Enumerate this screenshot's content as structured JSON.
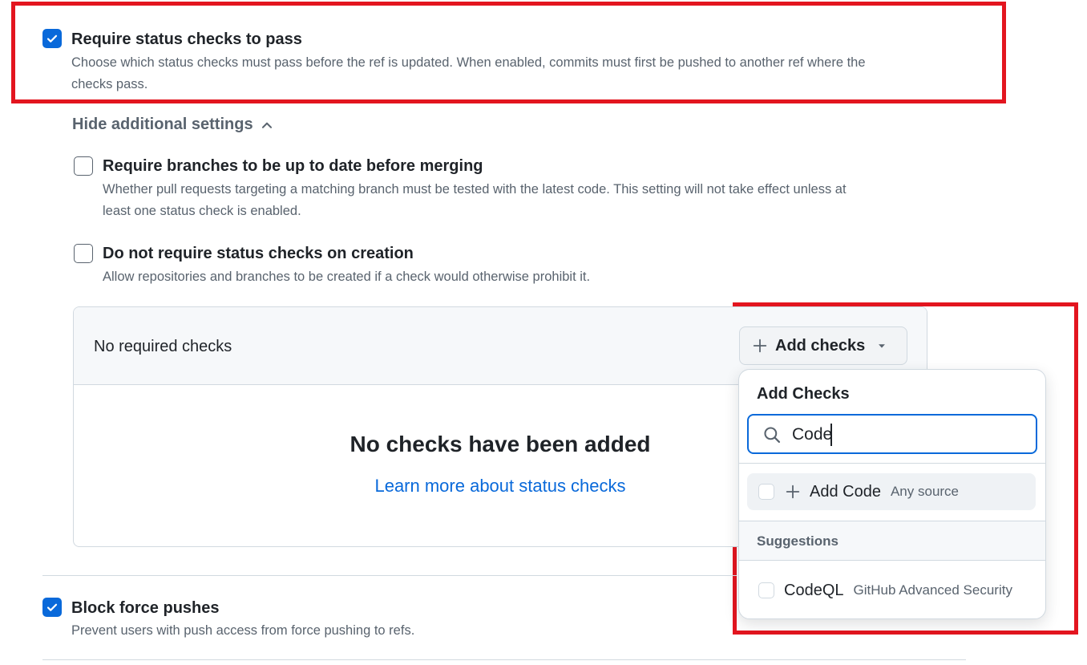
{
  "status_checks": {
    "title": "Require status checks to pass",
    "description_line1": "Choose which status checks must pass before the ref is updated. When enabled, commits must first be pushed to another ref where the",
    "description_line2": "checks pass.",
    "checked": true
  },
  "hide_settings_label": "Hide additional settings",
  "up_to_date": {
    "title": "Require branches to be up to date before merging",
    "description_line1": "Whether pull requests targeting a matching branch must be tested with the latest code. This setting will not take effect unless at",
    "description_line2": "least one status check is enabled.",
    "checked": false
  },
  "no_creation": {
    "title": "Do not require status checks on creation",
    "description": "Allow repositories and branches to be created if a check would otherwise prohibit it.",
    "checked": false
  },
  "checks_panel": {
    "header": "No required checks",
    "empty_title": "No checks have been added",
    "learn_more_link": "Learn more about status checks"
  },
  "add_checks_button": "Add checks",
  "dropdown": {
    "title": "Add Checks",
    "search_value": "Code",
    "add_item_label": "Add Code",
    "add_item_source": "Any source",
    "suggestions_label": "Suggestions",
    "suggestion_name": "CodeQL",
    "suggestion_source": "GitHub Advanced Security"
  },
  "force_push": {
    "title": "Block force pushes",
    "description": "Prevent users with push access from force pushing to refs.",
    "checked": true
  },
  "colors": {
    "accent": "#0969da",
    "highlight_red": "#e3151f",
    "muted_text": "#59636e"
  }
}
